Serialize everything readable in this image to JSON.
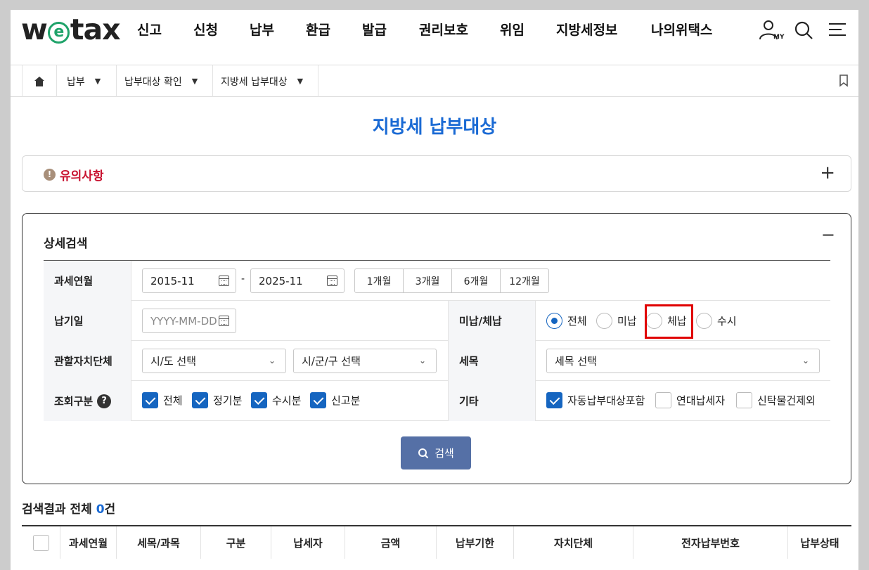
{
  "header": {
    "logo": {
      "pre": "w",
      "e": "e",
      "post": "tax"
    },
    "menu": [
      "신고",
      "신청",
      "납부",
      "환급",
      "발급",
      "권리보호",
      "위임",
      "지방세정보",
      "나의위택스"
    ],
    "icons": [
      "my-user-icon",
      "search-icon",
      "hamburger-menu-icon"
    ],
    "my_label": "MY"
  },
  "breadcrumb": {
    "items": [
      "납부",
      "납부대상 확인",
      "지방세 납부대상"
    ]
  },
  "page_title": "지방세 납부대상",
  "notice": {
    "label": "유의사항",
    "toggle": "+"
  },
  "search": {
    "title": "상세검색",
    "toggle": "−",
    "tax_month": {
      "label": "과세연월",
      "from": "2015-11",
      "to": "2025-11",
      "sep": "-",
      "periods": [
        "1개월",
        "3개월",
        "6개월",
        "12개월"
      ]
    },
    "due_date": {
      "label": "납기일",
      "placeholder": "YYYY-MM-DD"
    },
    "arrears": {
      "label": "미납/체납",
      "options": [
        "전체",
        "미납",
        "체납",
        "수시"
      ],
      "selected": "전체"
    },
    "jurisdiction": {
      "label": "관할자치단체",
      "sido": "시/도 선택",
      "sigungu": "시/군/구 선택"
    },
    "tax_item": {
      "label": "세목",
      "value": "세목 선택"
    },
    "query_type": {
      "label": "조회구분",
      "help": "?",
      "options": [
        {
          "label": "전체",
          "checked": true
        },
        {
          "label": "정기분",
          "checked": true
        },
        {
          "label": "수시분",
          "checked": true
        },
        {
          "label": "신고분",
          "checked": true
        }
      ]
    },
    "etc": {
      "label": "기타",
      "options": [
        {
          "label": "자동납부대상포함",
          "checked": true
        },
        {
          "label": "연대납세자",
          "checked": false
        },
        {
          "label": "신탁물건제외",
          "checked": false
        }
      ]
    },
    "button": "검색"
  },
  "results": {
    "title_pre": "검색결과 전체 ",
    "count": "0",
    "title_post": "건",
    "columns": [
      "과세연월",
      "세목/과목",
      "구분",
      "납세자",
      "금액",
      "납부기한",
      "자치단체",
      "전자납부번호",
      "납부상태"
    ]
  },
  "colors": {
    "accent": "#1a6ad4",
    "checked": "#1565c0",
    "notice": "#c8102e",
    "button": "#5570a6",
    "highlight": "#e00000"
  }
}
